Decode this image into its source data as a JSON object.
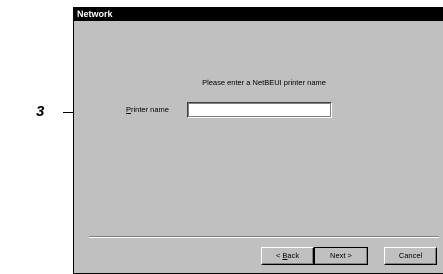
{
  "annotation": {
    "callout_number": "3"
  },
  "window": {
    "title": "Network",
    "prompt": "Please enter a NetBEUI printer name",
    "printer_name": {
      "label_mnemonic": "P",
      "label_rest": "rinter name",
      "value": ""
    },
    "buttons": {
      "back_pre": "< ",
      "back_mnemonic": "B",
      "back_rest": "ack",
      "next": "Next >",
      "cancel": "Cancel"
    }
  }
}
